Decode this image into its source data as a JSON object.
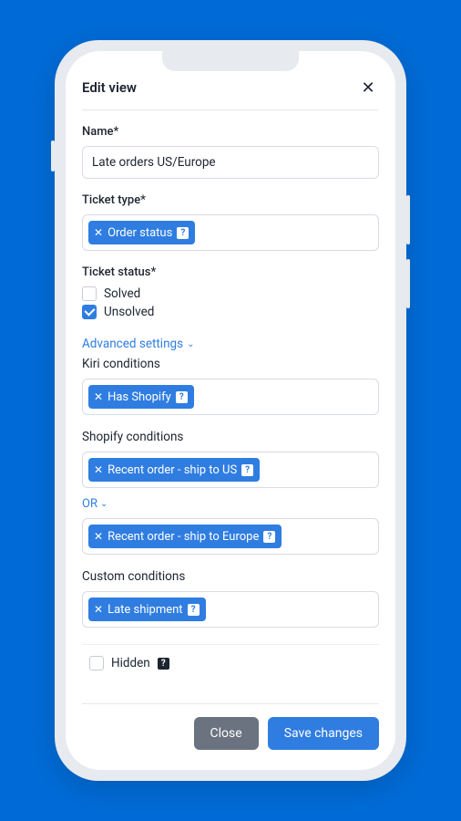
{
  "header": {
    "title": "Edit view"
  },
  "form": {
    "name_label": "Name*",
    "name_value": "Late orders US/Europe",
    "ticket_type_label": "Ticket type*",
    "ticket_type_tag": "Order status",
    "ticket_status_label": "Ticket status*",
    "status_options": [
      {
        "label": "Solved",
        "checked": false
      },
      {
        "label": "Unsolved",
        "checked": true
      }
    ],
    "advanced_link": "Advanced settings",
    "kiri_label": "Kiri conditions",
    "kiri_tag": "Has Shopify",
    "shopify_label": "Shopify conditions",
    "shopify_tag_1": "Recent order - ship to US",
    "or_label": "OR",
    "shopify_tag_2": "Recent order - ship to Europe",
    "custom_label": "Custom conditions",
    "custom_tag": "Late shipment",
    "hidden_label": "Hidden",
    "hidden_checked": false
  },
  "footer": {
    "close": "Close",
    "save": "Save changes"
  }
}
